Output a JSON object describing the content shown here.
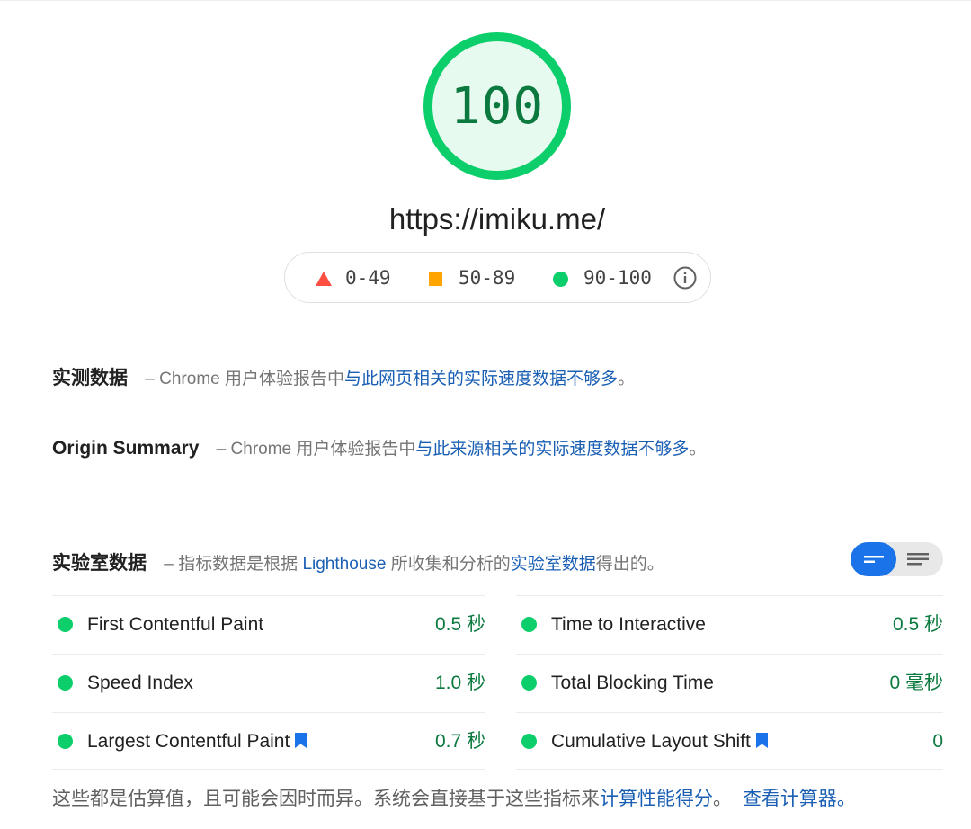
{
  "report": {
    "score": "100",
    "score_fraction": 1.0,
    "url": "https://imiku.me/"
  },
  "legend": {
    "fail_range": "0-49",
    "average_range": "50-89",
    "pass_range": "90-100",
    "colors": {
      "fail": "#ff4e42",
      "average": "#ffa400",
      "pass": "#0cce6b"
    },
    "info_icon": "info-icon"
  },
  "field_data": {
    "title": "实测数据",
    "dash": "–",
    "prefix": "Chrome 用户体验报告中",
    "link": "与此网页相关的实际速度数据不够多",
    "suffix": "。"
  },
  "origin_summary": {
    "title": "Origin Summary",
    "dash": "–",
    "prefix": "Chrome 用户体验报告中",
    "link": "与此来源相关的实际速度数据不够多",
    "suffix": "。"
  },
  "lab_data": {
    "title": "实验室数据",
    "dash": "–",
    "prefix": "指标数据是根据",
    "lighthouse": "Lighthouse",
    "middle": "所收集和分析的",
    "link": "实验室数据",
    "suffix": "得出的。"
  },
  "view_toggle": {
    "active": "collapsed",
    "accent": "#1a73e8"
  },
  "metrics": {
    "left": [
      {
        "label": "First Contentful Paint",
        "value": "0.5 秒",
        "bookmark": false
      },
      {
        "label": "Speed Index",
        "value": "1.0 秒",
        "bookmark": false
      },
      {
        "label": "Largest Contentful Paint",
        "value": "0.7 秒",
        "bookmark": true
      }
    ],
    "right": [
      {
        "label": "Time to Interactive",
        "value": "0.5 秒",
        "bookmark": false
      },
      {
        "label": "Total Blocking Time",
        "value": "0 毫秒",
        "bookmark": false
      },
      {
        "label": "Cumulative Layout Shift",
        "value": "0",
        "bookmark": true
      }
    ]
  },
  "footer": {
    "text": "这些都是估算值，且可能会因时而异。系统会直接基于这些指标来",
    "link1": "计算性能得分",
    "sep": "。",
    "link2": "查看计算器。"
  }
}
